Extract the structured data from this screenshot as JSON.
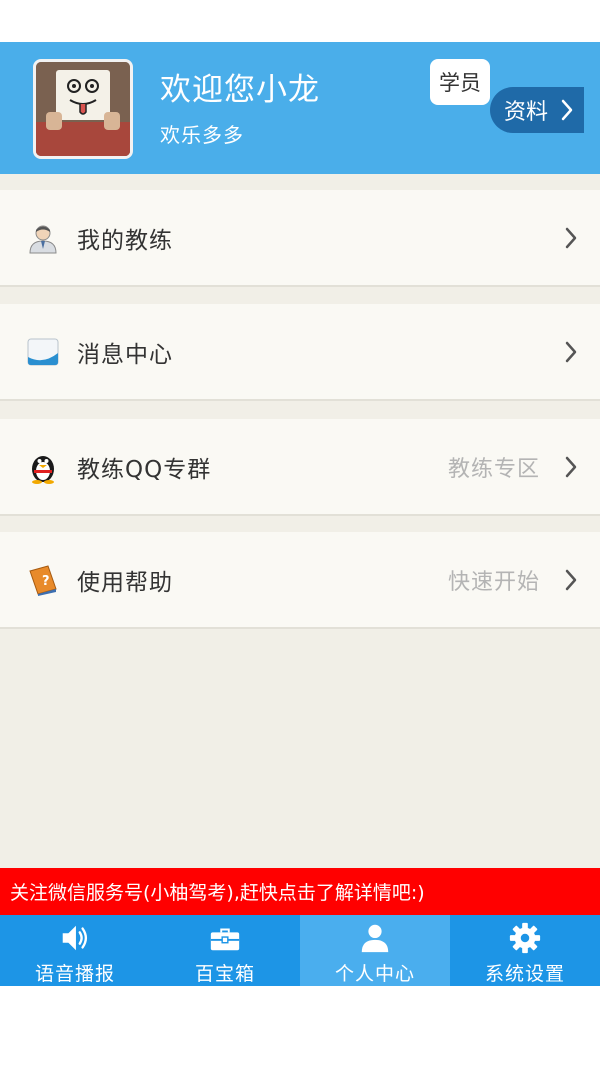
{
  "header": {
    "welcome": "欢迎您小龙",
    "subtitle": "欢乐多多",
    "role_badge": "学员",
    "profile_button": "资料"
  },
  "menu": [
    {
      "label": "我的教练",
      "hint": "",
      "icon": "coach-icon"
    },
    {
      "label": "消息中心",
      "hint": "",
      "icon": "message-icon"
    },
    {
      "label": "教练QQ专群",
      "hint": "教练专区",
      "icon": "qq-penguin-icon"
    },
    {
      "label": "使用帮助",
      "hint": "快速开始",
      "icon": "help-book-icon"
    }
  ],
  "banner": {
    "text": "关注微信服务号(小柚驾考),赶快点击了解详情吧:)"
  },
  "tabs": [
    {
      "label": "语音播报",
      "icon": "speaker-icon",
      "active": false
    },
    {
      "label": "百宝箱",
      "icon": "toolbox-icon",
      "active": false
    },
    {
      "label": "个人中心",
      "icon": "person-icon",
      "active": true
    },
    {
      "label": "系统设置",
      "icon": "gear-icon",
      "active": false
    }
  ],
  "colors": {
    "header_bg": "#4aaeea",
    "tabbar_bg": "#1d95e6",
    "banner_bg": "#ff0000",
    "profile_button_bg": "#1f6aa8"
  }
}
